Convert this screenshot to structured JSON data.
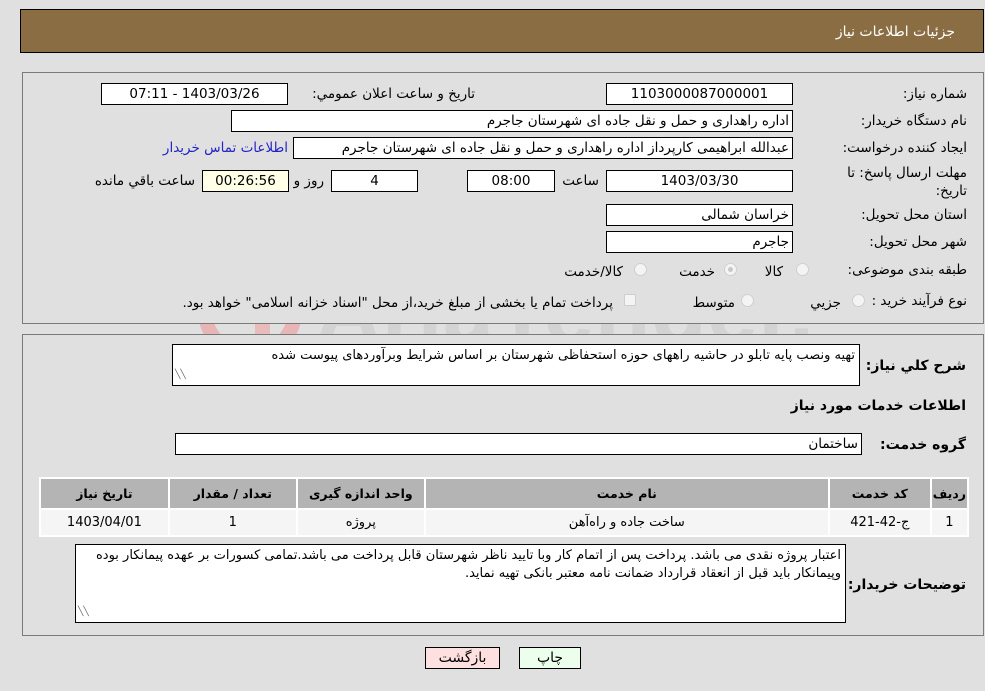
{
  "header": {
    "title": "جزئیات اطلاعات نیاز"
  },
  "info": {
    "need_number": {
      "label": "شماره نیاز:",
      "value": "1103000087000001"
    },
    "announce_datetime": {
      "label": "تاريخ و ساعت اعلان عمومي:",
      "value": "1403/03/26 - 07:11"
    },
    "buyer_org": {
      "label": "نام دستگاه خريدار:",
      "value": "اداره راهداری و حمل و نقل جاده ای شهرستان جاجرم"
    },
    "requester": {
      "label": "ایجاد کننده درخواست:",
      "value": "عبدالله ابراهیمی کارپرداز اداره راهداری و حمل و نقل جاده ای شهرستان جاجرم",
      "contact_link": "اطلاعات تماس خریدار"
    },
    "deadline": {
      "label_line1": "مهلت ارسال پاسخ: تا",
      "label_line2": "تاریخ:",
      "date": "1403/03/30",
      "time_label": "ساعت",
      "time": "08:00",
      "days": "4",
      "days_label": "روز و",
      "remaining": "00:26:56",
      "remaining_label": "ساعت باقي مانده"
    },
    "province": {
      "label": "استان محل تحویل:",
      "value": "خراسان شمالی"
    },
    "city": {
      "label": "شهر محل تحویل:",
      "value": "جاجرم"
    },
    "category": {
      "label": "طبقه بندی موضوعی:",
      "options": [
        "کالا",
        "خدمت",
        "کالا/خدمت"
      ],
      "selected": "خدمت"
    },
    "purchase_type": {
      "label": "نوع فرآیند خرید :",
      "options": [
        "جزيي",
        "متوسط"
      ],
      "selected": "",
      "treasury_checkbox_label": "پرداخت تمام یا بخشی از مبلغ خرید،از محل \"اسناد خزانه اسلامی\" خواهد بود."
    }
  },
  "description": {
    "label": "شرح کلي نياز:",
    "value": "تهیه ونصب پایه تابلو در حاشیه راههای حوزه استحفاظی شهرستان بر اساس شرایط وبرآوردهای پیوست شده"
  },
  "services": {
    "section_title": "اطلاعات خدمات مورد نیاز",
    "group_label": "گروه خدمت:",
    "group_value": "ساختمان",
    "columns": [
      "رديف",
      "کد خدمت",
      "نام خدمت",
      "واحد اندازه گیری",
      "تعداد / مقدار",
      "تاریخ نیاز"
    ],
    "rows": [
      [
        "1",
        "ج-42-421",
        "ساخت جاده و راه‌آهن",
        "پروژه",
        "1",
        "1403/04/01"
      ]
    ]
  },
  "buyer_notes": {
    "label": "توضیحات خریدار:",
    "value": "اعتبار پروژه نقدی می باشد. پرداخت پس از اتمام کار وبا تایید ناظر شهرستان قابل پرداخت می باشد.تمامی کسورات بر عهده پیمانکار بوده وپیمانکار باید قبل از انعقاد قرارداد ضمانت نامه معتبر بانکی تهیه نماید."
  },
  "buttons": {
    "print": "چاپ",
    "back": "بازگشت"
  },
  "watermark": {
    "text": "AriaTender.neT"
  },
  "colors": {
    "header_bg": "#8b6d43",
    "link": "#2323c8",
    "print_bg": "#ecffec",
    "back_bg": "#ffe0e0",
    "remaining_bg": "#ffffe8"
  }
}
